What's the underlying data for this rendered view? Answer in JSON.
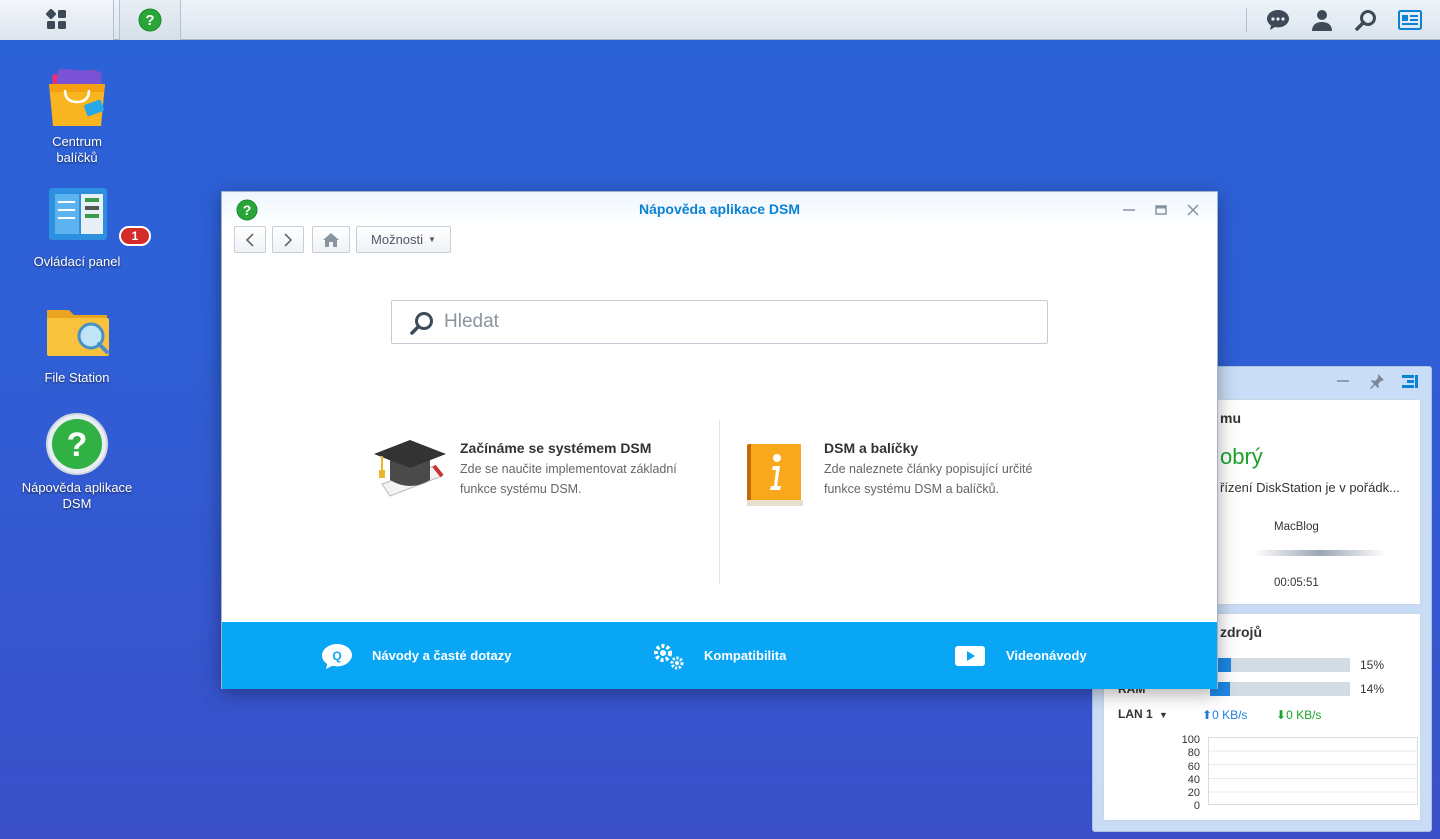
{
  "desktop": {
    "icons": [
      {
        "label": "Centrum\nbalíčků"
      },
      {
        "label": "Ovládací panel",
        "badge": "1"
      },
      {
        "label": "File Station"
      },
      {
        "label": "Nápověda aplikace\nDSM"
      }
    ]
  },
  "window": {
    "title": "Nápověda aplikace DSM",
    "options_label": "Možnosti",
    "search_placeholder": "Hledat",
    "features": [
      {
        "title": "Začínáme se systémem DSM",
        "desc": "Zde se naučite implementovat základní funkce systému DSM."
      },
      {
        "title": "DSM a balíčky",
        "desc": "Zde naleznete články popisující určité funkce systému DSM a balíčků."
      }
    ],
    "footer": [
      {
        "label": "Návody a časté dotazy"
      },
      {
        "label": "Kompatibilita"
      },
      {
        "label": "Videonávody"
      }
    ]
  },
  "widget": {
    "health_title_partial": "mu",
    "health_status_partial": "obrý",
    "health_message_partial": "řízení DiskStation je v pořádk...",
    "server_name": "MacBlog",
    "uptime": "00:05:51",
    "resources_title_partial": "zdrojů",
    "cpu_percent": "15%",
    "cpu_value": 0.15,
    "ram_label": "RAM",
    "ram_percent": "14%",
    "ram_value": 0.14,
    "lan_label": "LAN 1",
    "upload": "0 KB/s",
    "download": "0 KB/s",
    "chart_ticks": [
      "100",
      "80",
      "60",
      "40",
      "20",
      "0"
    ]
  },
  "colors": {
    "accent": "#08a6f4",
    "title_blue": "#0a82d6",
    "good_green": "#1aa32a"
  }
}
